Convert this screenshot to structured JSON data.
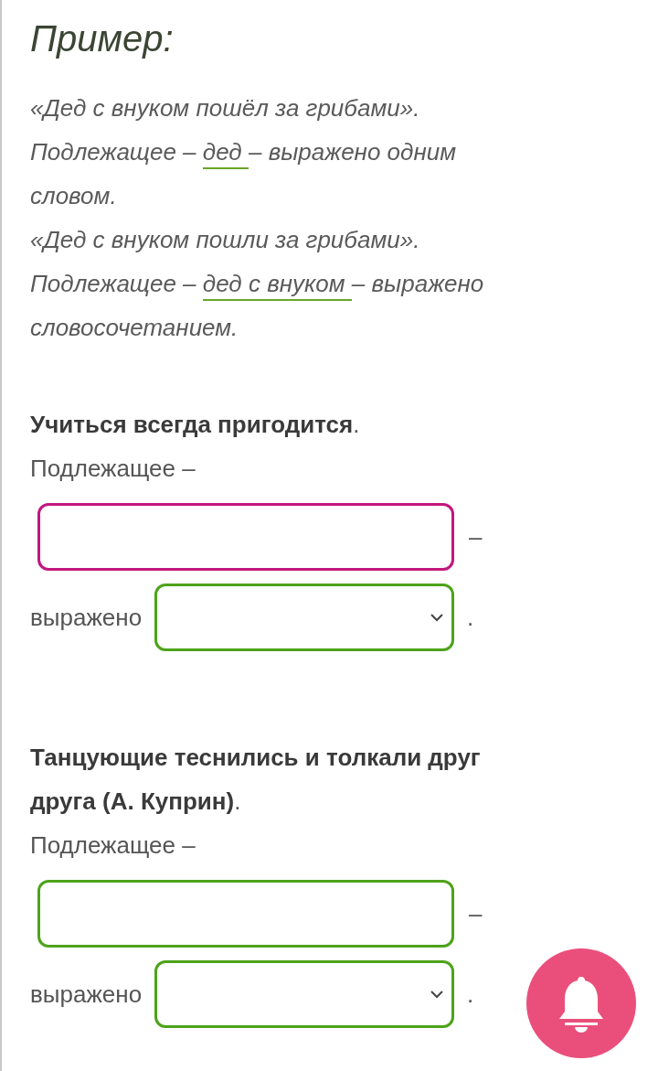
{
  "example": {
    "title": "Пример:",
    "lines": [
      [
        {
          "text": "«Дед с внуком пошёл за грибами».",
          "underlined": false
        }
      ],
      [
        {
          "text": "Подлежащее – ",
          "underlined": false
        },
        {
          "text": "дед ",
          "underlined": true
        },
        {
          "text": "– выражено одним",
          "underlined": false
        }
      ],
      [
        {
          "text": "словом.",
          "underlined": false
        }
      ],
      [
        {
          "text": "«Дед с внуком пошли за грибами».",
          "underlined": false
        }
      ],
      [
        {
          "text": "Подлежащее – ",
          "underlined": false
        },
        {
          "text": "дед с внуком ",
          "underlined": true
        },
        {
          "text": "– выражено",
          "underlined": false
        }
      ],
      [
        {
          "text": "словосочетанием.",
          "underlined": false
        }
      ]
    ]
  },
  "tasks": [
    {
      "sentence_lines": [
        "Учиться всегда пригодится"
      ],
      "end": ".",
      "label": "Подлежащее –",
      "input": {
        "focused": true
      },
      "dash": "–",
      "expressed_label": "выражено",
      "select_end": "."
    },
    {
      "sentence_lines": [
        "Танцующие теснились и толкали друг",
        "друга (А. Куприн)"
      ],
      "end": ".",
      "label": "Подлежащее –",
      "input": {
        "focused": false
      },
      "dash": "–",
      "expressed_label": "выражено",
      "select_end": "."
    }
  ],
  "fab": {
    "kind": "bell"
  }
}
